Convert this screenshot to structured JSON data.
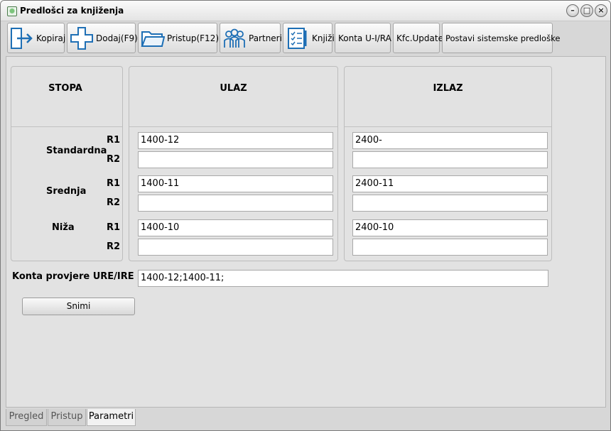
{
  "window": {
    "title": "Predlošci za knjiženja"
  },
  "toolbar": {
    "buttons": [
      {
        "label": "Kopiraj",
        "icon": "copy-arrow-icon"
      },
      {
        "label": "Dodaj(F9)",
        "icon": "plus-icon"
      },
      {
        "label": "Pristup(F12)",
        "icon": "folder-icon"
      },
      {
        "label": "Partneri",
        "icon": "people-icon"
      },
      {
        "label": "Knjiži",
        "icon": "ledger-icon"
      },
      {
        "label": "Konta U-I/RA"
      },
      {
        "label": "Kfc.Update"
      },
      {
        "label": "Postavi sistemske predloške"
      }
    ]
  },
  "table": {
    "headers": {
      "stopa": "STOPA",
      "ulaz": "ULAZ",
      "izlaz": "IZLAZ"
    },
    "row_labels": {
      "r1": "R1",
      "r2": "R2"
    },
    "rows": [
      {
        "name": "Standardna",
        "ulaz_r1": "1400-12",
        "ulaz_r2": "",
        "izlaz_r1": "2400-",
        "izlaz_r2": ""
      },
      {
        "name": "Srednja",
        "ulaz_r1": "1400-11",
        "ulaz_r2": "",
        "izlaz_r1": "2400-11",
        "izlaz_r2": ""
      },
      {
        "name": "Niža",
        "ulaz_r1": "1400-10",
        "ulaz_r2": "",
        "izlaz_r1": "2400-10",
        "izlaz_r2": ""
      }
    ]
  },
  "konta": {
    "label": "Konta provjere URE/IRE",
    "value": "1400-12;1400-11;"
  },
  "save_label": "Snimi",
  "tabs": [
    {
      "label": "Pregled",
      "active": false
    },
    {
      "label": "Pristup",
      "active": false
    },
    {
      "label": "Parametri",
      "active": true
    }
  ]
}
